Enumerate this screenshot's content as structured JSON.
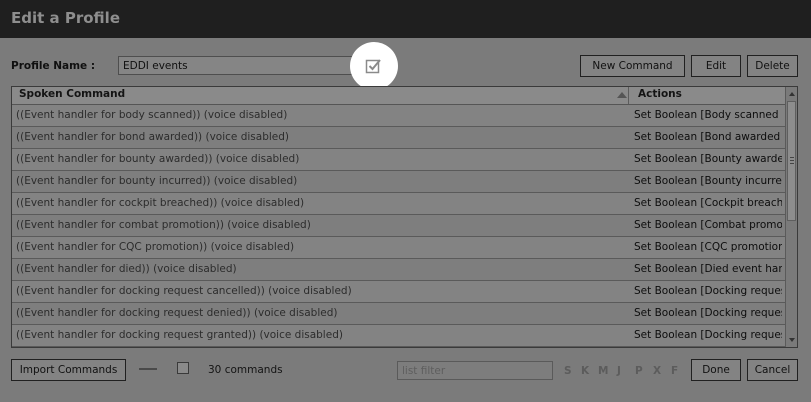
{
  "window": {
    "title": "Edit a Profile"
  },
  "profile": {
    "name_label": "Profile Name :",
    "name_value": "EDDI events"
  },
  "toolbar": {
    "new_command": "New Command",
    "edit": "Edit",
    "delete": "Delete"
  },
  "grid": {
    "columns": {
      "spoken": "Spoken Command",
      "actions": "Actions"
    },
    "rows": [
      {
        "spoken": "((Event handler for body scanned))  (voice disabled)",
        "action": "Set Boolean [Body scanned event handler]"
      },
      {
        "spoken": "((Event handler for bond awarded))  (voice disabled)",
        "action": "Set Boolean [Bond awarded event handler]"
      },
      {
        "spoken": "((Event handler for bounty awarded))  (voice disabled)",
        "action": "Set Boolean [Bounty awarded event handler]"
      },
      {
        "spoken": "((Event handler for bounty incurred))  (voice disabled)",
        "action": "Set Boolean [Bounty incurred event handler]"
      },
      {
        "spoken": "((Event handler for cockpit breached))  (voice disabled)",
        "action": "Set Boolean [Cockpit breached event handler]"
      },
      {
        "spoken": "((Event handler for combat promotion))  (voice disabled)",
        "action": "Set Boolean [Combat promotion event handler]"
      },
      {
        "spoken": "((Event handler for CQC promotion))  (voice disabled)",
        "action": "Set Boolean [CQC promotion event handler]"
      },
      {
        "spoken": "((Event handler for died))  (voice disabled)",
        "action": "Set Boolean [Died event handler]"
      },
      {
        "spoken": "((Event handler for docking request cancelled))  (voice disabled)",
        "action": "Set Boolean [Docking request cancelled event handler]"
      },
      {
        "spoken": "((Event handler for docking request denied))  (voice disabled)",
        "action": "Set Boolean [Docking request denied event handler]"
      },
      {
        "spoken": "((Event handler for docking request granted))  (voice disabled)",
        "action": "Set Boolean [Docking request granted event handler]"
      }
    ]
  },
  "footer": {
    "import_commands": "Import Commands",
    "command_count": "30 commands",
    "filter_placeholder": "list filter",
    "letters": [
      "S",
      "K",
      "M",
      "J",
      "P",
      "X",
      "F"
    ],
    "done": "Done",
    "cancel": "Cancel"
  },
  "icons": {
    "checkbox_highlight": "checkbox-checked-icon"
  },
  "colors": {
    "titlebar": "#1f1f1f",
    "dimmed_background": "#7b7b7b",
    "highlight": "#ffffff"
  }
}
